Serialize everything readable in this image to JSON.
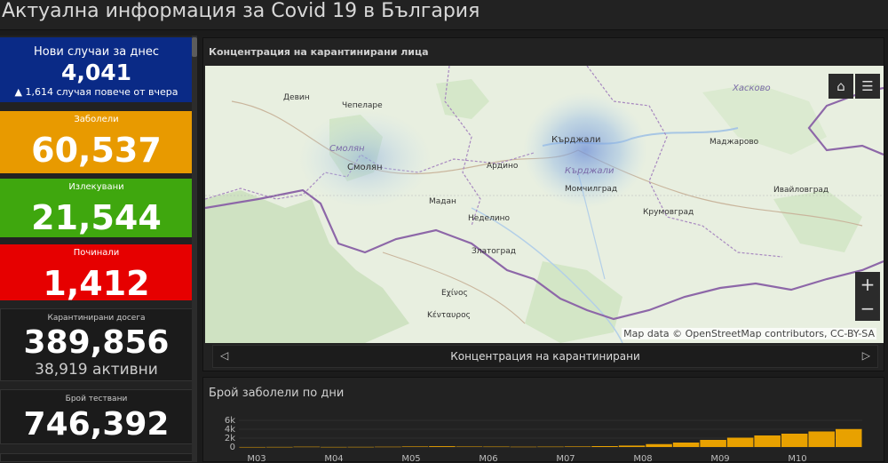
{
  "header": {
    "title": "Актуална информация за Covid 19 в България"
  },
  "cards": {
    "new_cases": {
      "label": "Нови случаи за днес",
      "value": "4,041",
      "sub": "▲ 1,614 случая повече от вчера"
    },
    "infected": {
      "label": "Заболели",
      "value": "60,537"
    },
    "recovered": {
      "label": "Излекувани",
      "value": "21,544"
    },
    "deaths": {
      "label": "Починали",
      "value": "1,412"
    },
    "quarantined": {
      "label": "Карантинирани досега",
      "value": "389,856",
      "sub": "38,919 активни"
    },
    "tests": {
      "label": "Брой тествани",
      "value": "746,392"
    }
  },
  "map": {
    "title": "Концентрация на карантинирани лица",
    "attribution": "Map data © OpenStreetMap contributors, CC-BY-SA",
    "places": [
      "Девин",
      "Чепеларе",
      "Смолян",
      "Смолян",
      "Ардино",
      "Кърджали",
      "Кърджали",
      "Хасково",
      "Маджарово",
      "Момчилград",
      "Ивайловград",
      "Мадан",
      "Неделино",
      "Крумовград",
      "Златоград",
      "Εχίνος",
      "Κένταυρος"
    ],
    "home_icon": "home-icon",
    "legend_icon": "list-icon",
    "zoom_in": "+",
    "zoom_out": "−",
    "carousel_caption": "Концентрация на карантинирани"
  },
  "daily_chart": {
    "title": "Брой заболели по дни",
    "ytick_labels": [
      "6k",
      "4k",
      "2k",
      "0"
    ],
    "xtick_labels": [
      "M03",
      "M04",
      "M05",
      "M06",
      "M07",
      "M08",
      "M09",
      "M10"
    ]
  },
  "chart_data": {
    "type": "bar",
    "title": "Брой заболели по дни",
    "xlabel": "",
    "ylabel": "",
    "ylim": [
      0,
      6000
    ],
    "categories": [
      "M03",
      "M04",
      "M05",
      "M06",
      "M07",
      "M08",
      "M09",
      "M10"
    ],
    "series": [
      {
        "values": [
          4,
          20,
          70,
          20,
          30,
          60,
          120,
          180,
          100,
          90,
          60,
          80,
          120,
          200,
          320,
          650,
          1000,
          1600,
          2100,
          2600,
          3000,
          3500,
          4041
        ]
      }
    ],
    "grid": true,
    "color": "#e8a100"
  },
  "colors": {
    "new_cases": "#0a2a86",
    "infected": "#e89a00",
    "recovered": "#3fa70e",
    "deaths": "#e60000"
  }
}
